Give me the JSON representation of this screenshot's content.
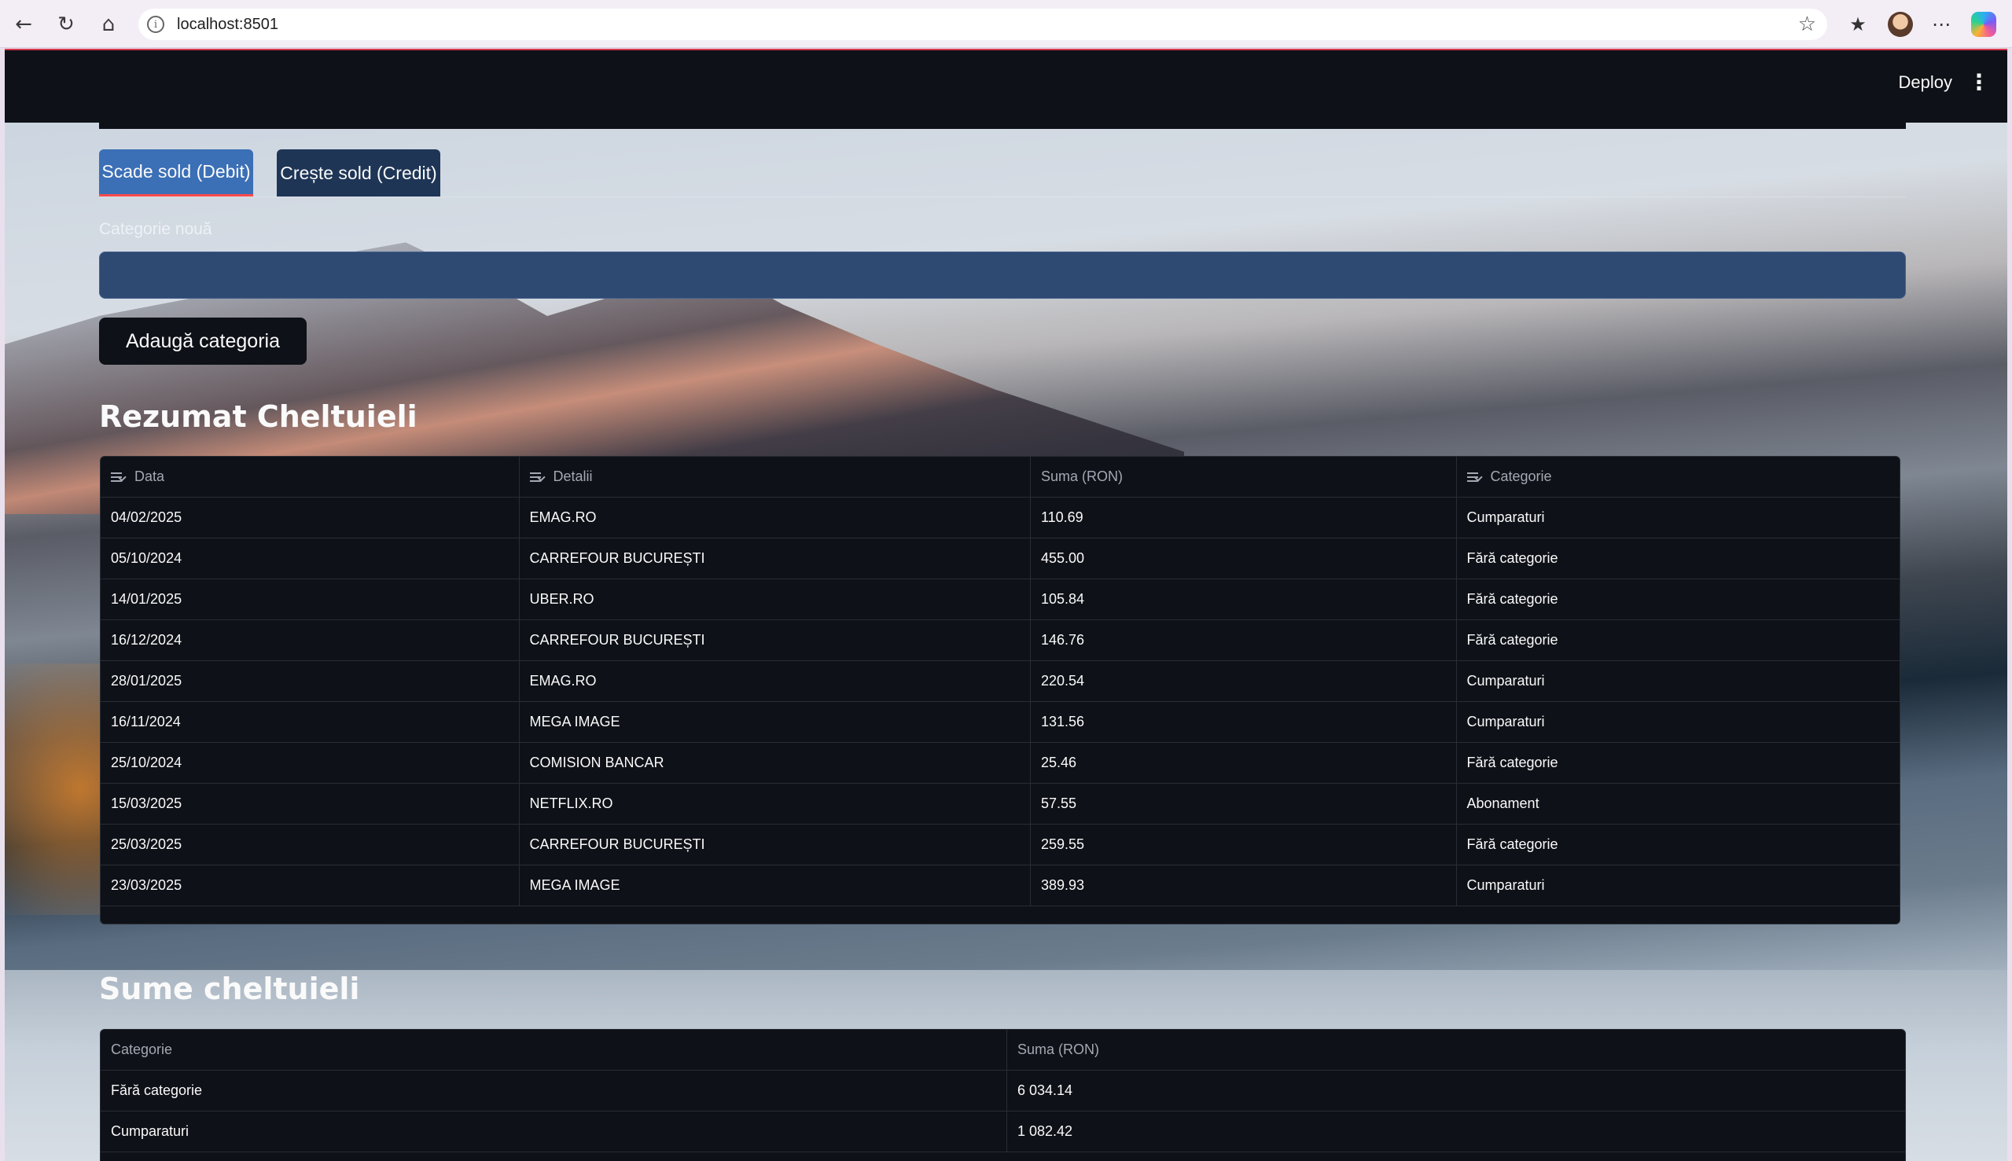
{
  "browser": {
    "url": "localhost:8501"
  },
  "header": {
    "deploy_label": "Deploy",
    "menu_icon": "kebab-menu-icon"
  },
  "tabs": [
    {
      "label": "Scade sold (Debit)",
      "active": true
    },
    {
      "label": "Crește sold (Credit)",
      "active": false
    }
  ],
  "new_category": {
    "label": "Categorie nouă",
    "value": "",
    "button_label": "Adaugă categoria"
  },
  "summary": {
    "title": "Rezumat Cheltuieli",
    "columns": [
      "Data",
      "Detalii",
      "Suma (RON)",
      "Categorie"
    ],
    "rows": [
      [
        "04/02/2025",
        "EMAG.RO",
        "110.69",
        "Cumparaturi"
      ],
      [
        "05/10/2024",
        "CARREFOUR BUCUREȘTI",
        "455.00",
        "Fără categorie"
      ],
      [
        "14/01/2025",
        "UBER.RO",
        "105.84",
        "Fără categorie"
      ],
      [
        "16/12/2024",
        "CARREFOUR BUCUREȘTI",
        "146.76",
        "Fără categorie"
      ],
      [
        "28/01/2025",
        "EMAG.RO",
        "220.54",
        "Cumparaturi"
      ],
      [
        "16/11/2024",
        "MEGA IMAGE",
        "131.56",
        "Cumparaturi"
      ],
      [
        "25/10/2024",
        "COMISION BANCAR",
        "25.46",
        "Fără categorie"
      ],
      [
        "15/03/2025",
        "NETFLIX.RO",
        "57.55",
        "Abonament"
      ],
      [
        "25/03/2025",
        "CARREFOUR BUCUREȘTI",
        "259.55",
        "Fără categorie"
      ],
      [
        "23/03/2025",
        "MEGA IMAGE",
        "389.93",
        "Cumparaturi"
      ]
    ]
  },
  "totals": {
    "title": "Sume cheltuieli",
    "columns": [
      "Categorie",
      "Suma (RON)"
    ],
    "rows": [
      [
        "Fără categorie",
        "6 034.14"
      ],
      [
        "Cumparaturi",
        "1 082.42"
      ]
    ]
  }
}
